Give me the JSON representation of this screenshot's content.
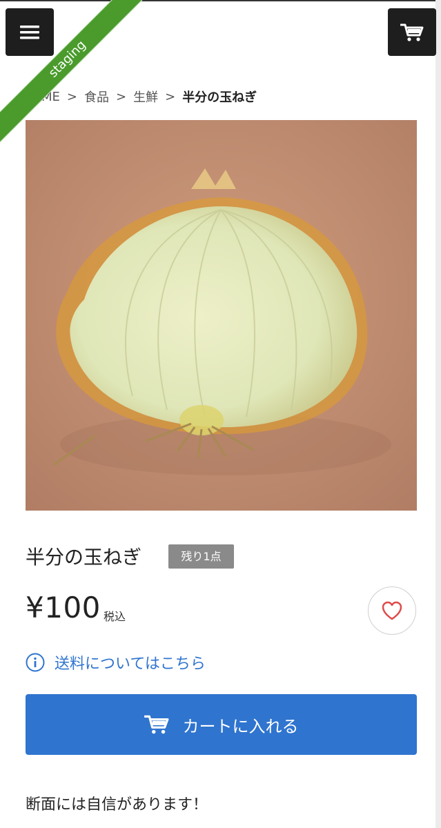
{
  "env_ribbon": "staging",
  "header": {
    "menu_icon": "hamburger-icon",
    "cart_icon": "cart-icon"
  },
  "breadcrumb": {
    "items": [
      "ME",
      "食品",
      "生鮮"
    ],
    "current": "半分の玉ねぎ"
  },
  "product": {
    "image_alt": "half onion",
    "title": "半分の玉ねぎ",
    "stock_badge": "残り1点",
    "price": "¥100",
    "tax_label": "税込",
    "favorite_icon": "heart-icon",
    "shipping_link": "送料についてはこちら",
    "shipping_icon": "info-icon",
    "add_to_cart_label": "カートに入れる",
    "description": "断面には自信があります！"
  },
  "colors": {
    "accent": "#2f74cf",
    "ribbon": "#4a9b2c",
    "badge": "#8a8a8a",
    "header_btn": "#1e1e1e",
    "heart": "#e04a4a"
  }
}
